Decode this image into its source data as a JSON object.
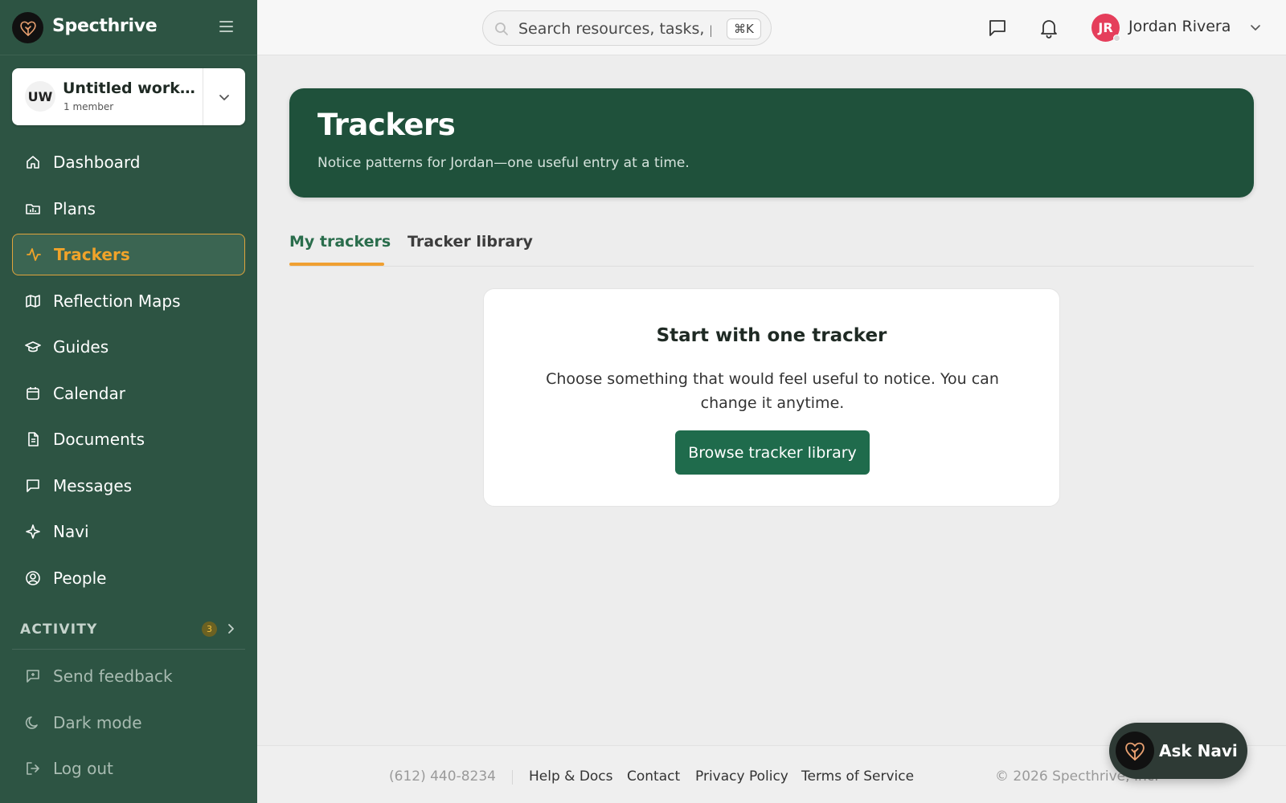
{
  "brand": {
    "name": "Specthrive",
    "logo_icon": "heart-tree-icon"
  },
  "workspace": {
    "initials": "UW",
    "name": "Untitled work...",
    "members": "1 member"
  },
  "sidebar": {
    "items": [
      {
        "label": "Dashboard",
        "icon": "home-icon"
      },
      {
        "label": "Plans",
        "icon": "folder-chart-icon"
      },
      {
        "label": "Trackers",
        "icon": "activity-icon",
        "active": true
      },
      {
        "label": "Reflection Maps",
        "icon": "map-icon"
      },
      {
        "label": "Guides",
        "icon": "graduation-cap-icon"
      },
      {
        "label": "Calendar",
        "icon": "calendar-icon"
      },
      {
        "label": "Documents",
        "icon": "document-icon"
      },
      {
        "label": "Messages",
        "icon": "message-icon"
      },
      {
        "label": "Navi",
        "icon": "sparkle-icon"
      },
      {
        "label": "People",
        "icon": "user-circle-icon"
      }
    ],
    "activity": {
      "label": "ACTIVITY",
      "count": "3"
    },
    "bottom_items": [
      {
        "label": "Send feedback",
        "icon": "feedback-icon"
      },
      {
        "label": "Dark mode",
        "icon": "moon-icon"
      },
      {
        "label": "Log out",
        "icon": "logout-icon"
      }
    ]
  },
  "topbar": {
    "search_placeholder": "Search resources, tasks, people…",
    "shortcut": "⌘K",
    "user": {
      "initials": "JR",
      "name": "Jordan Rivera"
    }
  },
  "hero": {
    "title": "Trackers",
    "subtitle": "Notice patterns for Jordan—one useful entry at a time."
  },
  "tabs": [
    {
      "label": "My trackers",
      "active": true
    },
    {
      "label": "Tracker library"
    }
  ],
  "empty_state": {
    "title": "Start with one tracker",
    "description": "Choose something that would feel useful to notice. You can change it anytime.",
    "button": "Browse tracker library"
  },
  "footer": {
    "phone": "(612) 440-8234",
    "links": [
      "Help & Docs",
      "Contact",
      "Privacy Policy",
      "Terms of Service"
    ],
    "copyright": "© 2026 Specthrive, Inc."
  },
  "ask_navi": {
    "label": "Ask Navi"
  },
  "colors": {
    "sidebar_bg": "#2d5443",
    "hero_bg": "#1f513b",
    "accent_orange": "#f0a032",
    "primary_button": "#1f6b4c",
    "avatar_red": "#e53e5b"
  }
}
